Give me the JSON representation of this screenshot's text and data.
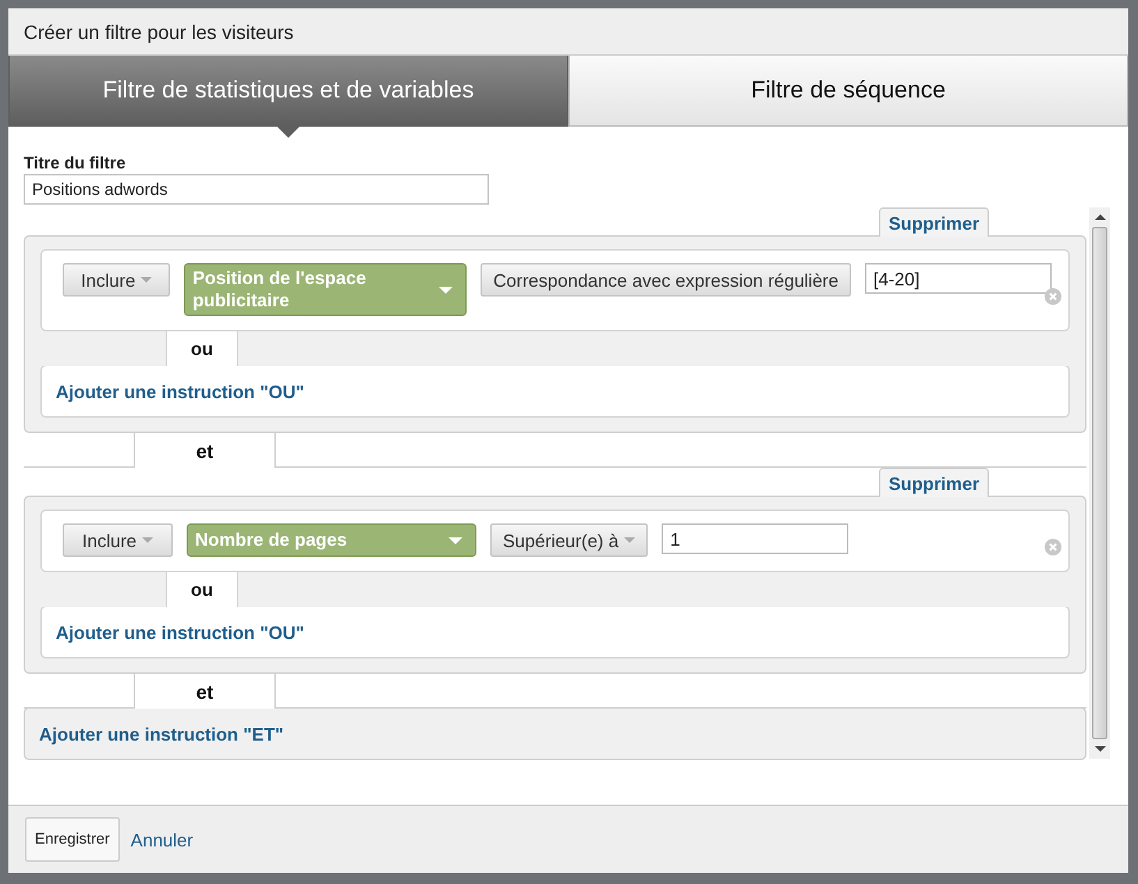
{
  "dialog": {
    "title": "Créer un filtre pour les visiteurs"
  },
  "tabs": [
    {
      "label": "Filtre de statistiques et de variables",
      "selected": true
    },
    {
      "label": "Filtre de séquence",
      "selected": false
    }
  ],
  "filter_title": {
    "label": "Titre du filtre",
    "value": "Positions adwords"
  },
  "groups": [
    {
      "delete": "Supprimer",
      "conditions": [
        {
          "mode": "Inclure",
          "dimension": "Position de l'espace publicitaire",
          "operator": "Correspondance avec expression régulière",
          "operator_dropdown": false,
          "value": "[4-20]"
        }
      ],
      "or_label": "ou",
      "add_or": "Ajouter une instruction \"OU\"",
      "and_label": "et"
    },
    {
      "delete": "Supprimer",
      "conditions": [
        {
          "mode": "Inclure",
          "dimension": "Nombre de pages",
          "operator": "Supérieur(e) à",
          "operator_dropdown": true,
          "value": "1"
        }
      ],
      "or_label": "ou",
      "add_or": "Ajouter une instruction \"OU\"",
      "and_label": "et"
    }
  ],
  "add_and": "Ajouter une instruction \"ET\"",
  "footer": {
    "save": "Enregistrer",
    "cancel": "Annuler"
  }
}
